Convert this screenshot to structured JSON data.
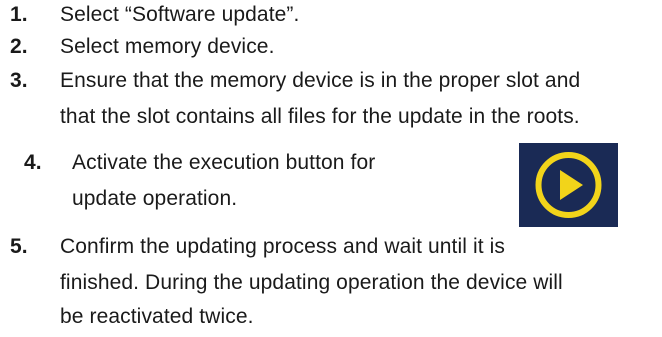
{
  "steps": [
    {
      "number": "1.",
      "lines": [
        "Select “Software update”."
      ]
    },
    {
      "number": "2.",
      "lines": [
        "Select memory device."
      ]
    },
    {
      "number": "3.",
      "lines": [
        "Ensure that the memory device is in the proper slot and",
        "that the slot contains all files for the update in the roots."
      ]
    },
    {
      "number": "4.",
      "lines": [
        "Activate the execution button for",
        "update operation."
      ]
    },
    {
      "number": "5.",
      "lines": [
        "Confirm the updating process and wait until it is",
        "finished. During the updating operation the device will",
        "be reactivated twice."
      ]
    }
  ],
  "play_button": {
    "icon": "play-circle-icon",
    "background_color": "#1a2a55",
    "icon_color": "#f2d41a"
  }
}
